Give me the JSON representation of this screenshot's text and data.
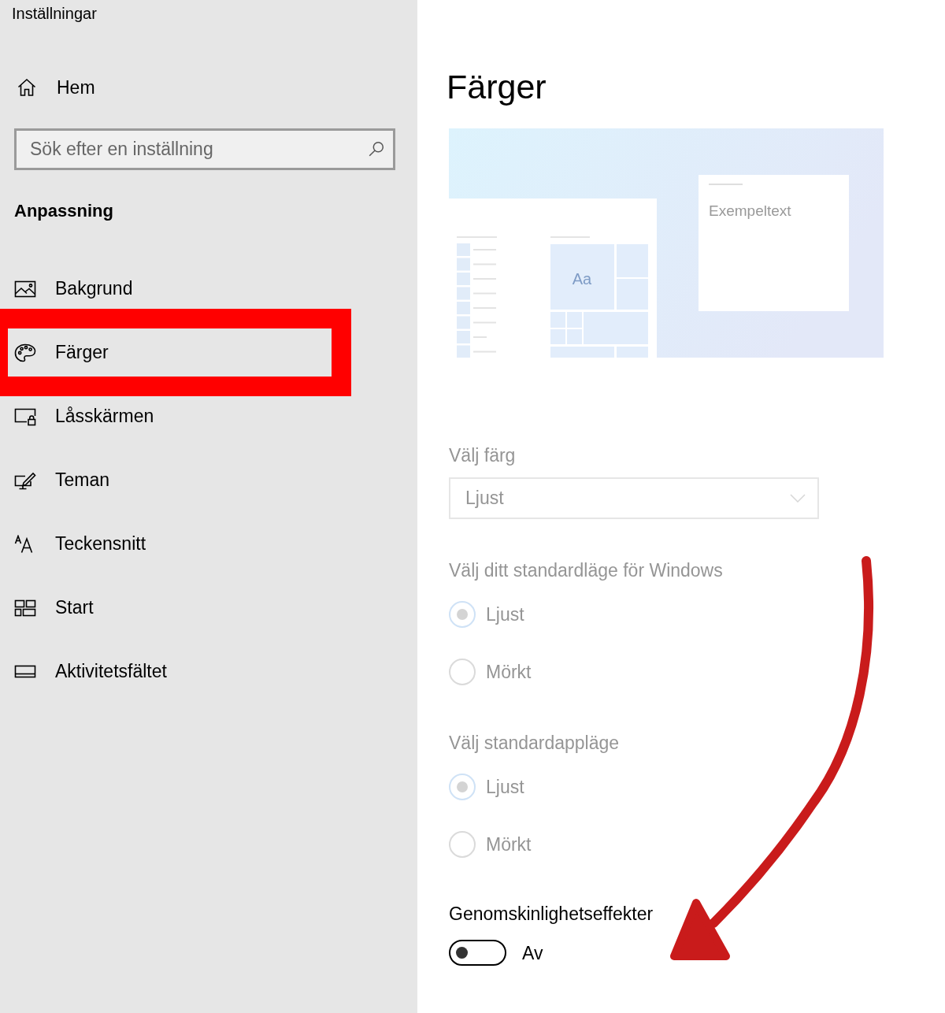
{
  "window": {
    "title": "Inställningar"
  },
  "sidebar": {
    "home": {
      "label": "Hem"
    },
    "search": {
      "placeholder": "Sök efter en inställning"
    },
    "section_title": "Anpassning",
    "items": [
      {
        "label": "Bakgrund",
        "selected": false
      },
      {
        "label": "Färger",
        "selected": true
      },
      {
        "label": "Låsskärmen",
        "selected": false
      },
      {
        "label": "Teman",
        "selected": false
      },
      {
        "label": "Teckensnitt",
        "selected": false
      },
      {
        "label": "Start",
        "selected": false
      },
      {
        "label": "Aktivitetsfältet",
        "selected": false
      }
    ]
  },
  "page": {
    "title": "Färger",
    "preview": {
      "tile_label": "Aa",
      "sample_text": "Exempeltext"
    },
    "color_choice": {
      "label": "Välj färg",
      "value": "Ljust",
      "disabled": true
    },
    "windows_mode": {
      "label": "Välj ditt standardläge för Windows",
      "disabled": true,
      "options": [
        {
          "label": "Ljust",
          "selected": true
        },
        {
          "label": "Mörkt",
          "selected": false
        }
      ]
    },
    "app_mode": {
      "label": "Välj standardappläge",
      "disabled": true,
      "options": [
        {
          "label": "Ljust",
          "selected": true
        },
        {
          "label": "Mörkt",
          "selected": false
        }
      ]
    },
    "transparency": {
      "label": "Genomskinlighetseffekter",
      "on": false,
      "state_text": "Av"
    }
  }
}
